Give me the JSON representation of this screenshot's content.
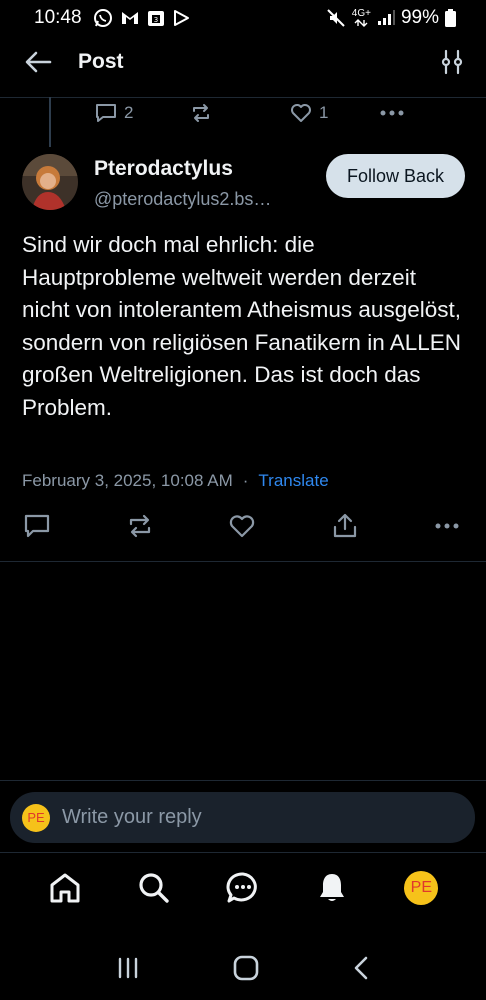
{
  "status_bar": {
    "time": "10:48",
    "network": "4G+",
    "battery": "99%",
    "icons": [
      "whatsapp-icon",
      "gmail-icon",
      "calendar-icon",
      "play-store-icon",
      "mute-icon",
      "signal-icon",
      "battery-icon"
    ]
  },
  "header": {
    "title": "Post",
    "back_icon": "arrow-left-icon",
    "filter_icon": "sliders-icon"
  },
  "previous_post_actions": {
    "replies": "2",
    "reposts": "",
    "likes": "1"
  },
  "post": {
    "author_name": "Pterodactylus",
    "author_handle": "@pterodactylus2.bs…",
    "follow_label": "Follow Back",
    "text": "Sind wir doch mal ehrlich:  die Hauptprobleme weltweit werden derzeit nicht von intolerantem Atheismus ausgelöst, sondern von religiösen Fanatikern in ALLEN großen Weltreligionen. Das ist doch das Problem.",
    "timestamp": "February 3, 2025, 10:08 AM",
    "separator": "·",
    "translate_label": "Translate"
  },
  "reply": {
    "avatar_initials": "PE",
    "placeholder": "Write your reply"
  },
  "tabbar": {
    "items": [
      "home-icon",
      "search-icon",
      "chat-icon",
      "notifications-icon",
      "profile-avatar"
    ],
    "avatar_initials": "PE"
  },
  "colors": {
    "background": "#000000",
    "accent": "#2f88ef",
    "muted": "#8b98a6",
    "follow_bg": "#d6e1ea",
    "avatar_yellow": "#f6c21a"
  }
}
